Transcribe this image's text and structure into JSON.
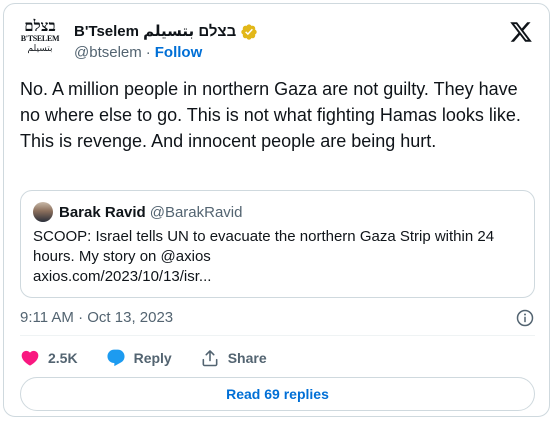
{
  "author": {
    "logo_hebrew": "בצלם",
    "logo_english": "B'TSELEM",
    "logo_arabic": "بتسيلم",
    "display_name": "B'Tselem בצלם بتسيلم",
    "handle": "@btselem",
    "separator": "·",
    "follow_label": "Follow",
    "verified_color": "#e2b719"
  },
  "tweet": {
    "text": "No. A million people in northern Gaza are not guilty. They have no where else to go. This is not what fighting Hamas looks like. This is revenge. And innocent people are being hurt."
  },
  "quote": {
    "name": "Barak Ravid",
    "handle": "@BarakRavid",
    "lines": [
      "SCOOP: Israel tells UN to evacuate the northern Gaza Strip within 24",
      "hours. My story on @axios",
      "axios.com/2023/10/13/isr..."
    ]
  },
  "meta": {
    "timestamp": "9:11 AM · Oct 13, 2023"
  },
  "actions": {
    "likes": "2.5K",
    "reply_label": "Reply",
    "share_label": "Share",
    "like_color": "#f91880",
    "reply_color": "#1d9bf0"
  },
  "read_replies_label": "Read 69 replies"
}
